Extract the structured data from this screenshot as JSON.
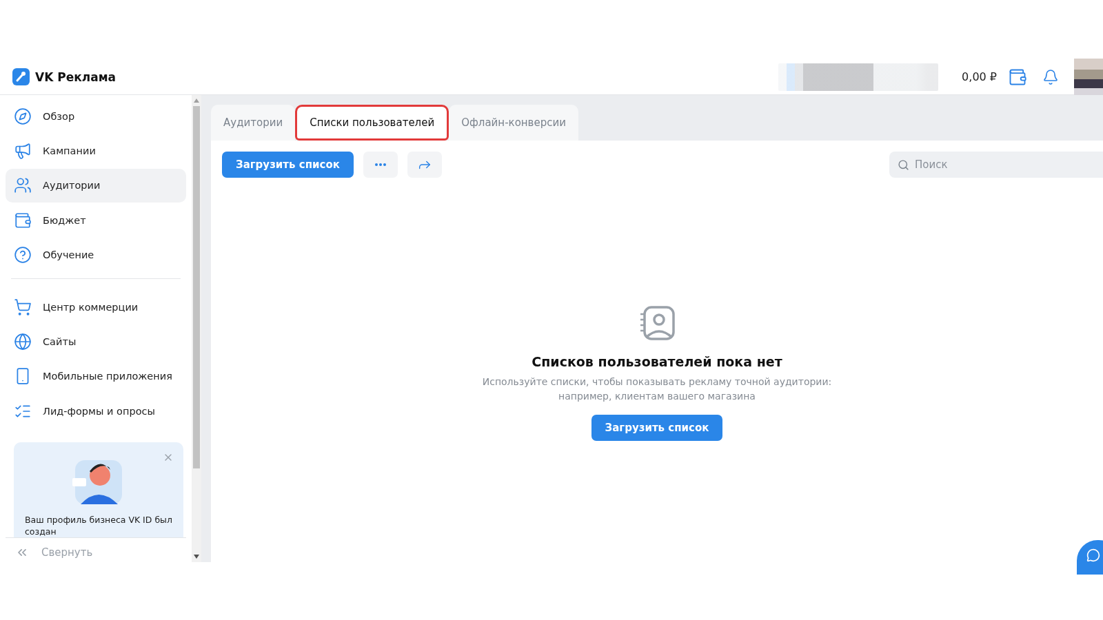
{
  "header": {
    "logo_text": "VK Реклама",
    "balance": "0,00 ₽"
  },
  "sidebar": {
    "sections": [
      [
        {
          "label": "Обзор",
          "selected": false
        },
        {
          "label": "Кампании",
          "selected": false
        },
        {
          "label": "Аудитории",
          "selected": true
        },
        {
          "label": "Бюджет",
          "selected": false
        },
        {
          "label": "Обучение",
          "selected": false
        }
      ],
      [
        {
          "label": "Центр коммерции",
          "selected": false
        },
        {
          "label": "Сайты",
          "selected": false
        },
        {
          "label": "Мобильные приложения",
          "selected": false
        },
        {
          "label": "Лид-формы и опросы",
          "selected": false
        }
      ]
    ],
    "promo": {
      "text": "Ваш профиль бизнеса VK ID был создан"
    },
    "collapse": "Свернуть"
  },
  "tabs": [
    {
      "label": "Аудитории",
      "selected": false
    },
    {
      "label": "Списки пользователей",
      "selected": true
    },
    {
      "label": "Офлайн-конверсии",
      "selected": false
    }
  ],
  "toolbar": {
    "upload": "Загрузить список"
  },
  "search": {
    "placeholder": "Поиск"
  },
  "empty_state": {
    "title": "Списков пользователей пока нет",
    "description": "Используйте списки, чтобы показывать рекламу точной аудитории: например, клиентам вашего магазина",
    "button": "Загрузить список"
  }
}
